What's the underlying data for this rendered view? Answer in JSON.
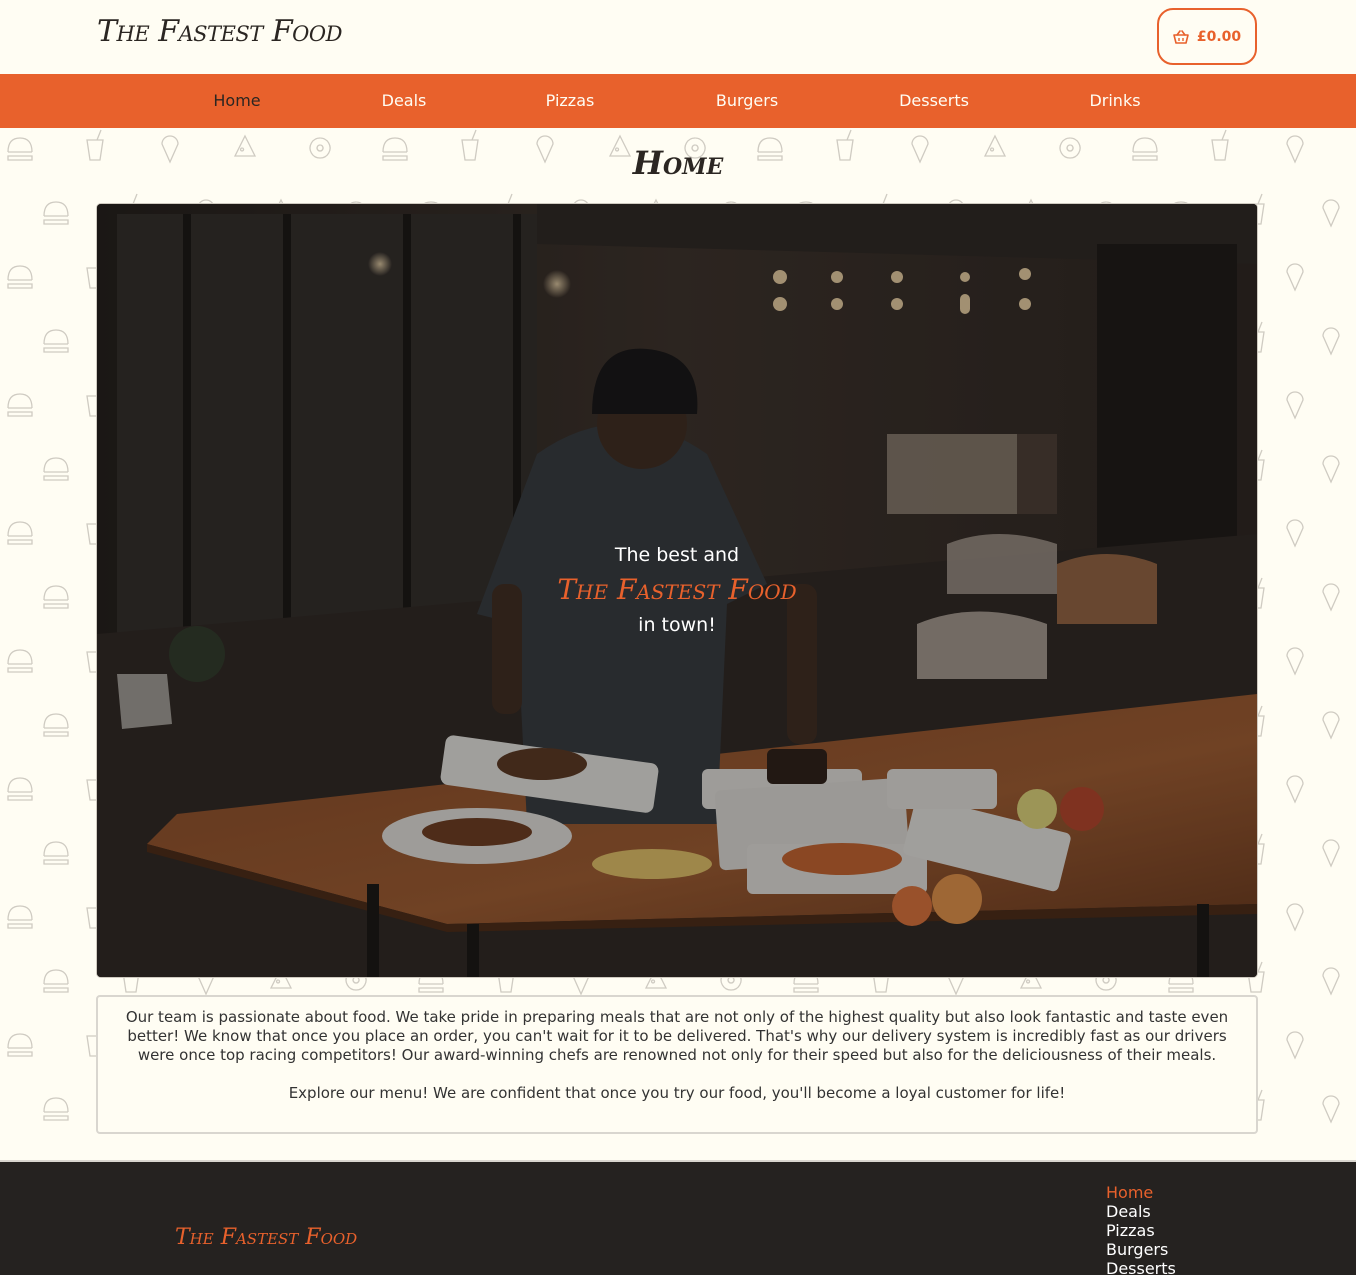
{
  "header": {
    "brand": "The Fastest Food",
    "cart_icon": "basket-icon",
    "cart_total": "£0.00"
  },
  "nav": {
    "items": [
      {
        "label": "Home",
        "active": true
      },
      {
        "label": "Deals",
        "active": false
      },
      {
        "label": "Pizzas",
        "active": false
      },
      {
        "label": "Burgers",
        "active": false
      },
      {
        "label": "Desserts",
        "active": false
      },
      {
        "label": "Drinks",
        "active": false
      }
    ]
  },
  "page": {
    "title": "Home"
  },
  "hero": {
    "line1": "The best and",
    "brand": "The Fastest Food",
    "line3": "in town!"
  },
  "about": {
    "paragraph1": "Our team is passionate about food. We take pride in preparing meals that are not only of the highest quality but also look fantastic and taste even better! We know that once you place an order, you can't wait for it to be delivered. That's why our delivery system is incredibly fast as our drivers were once top racing competitors! Our award-winning chefs are renowned not only for their speed but also for the deliciousness of their meals.",
    "paragraph2": "Explore our menu! We are confident that once you try our food, you'll become a loyal customer for life!"
  },
  "footer": {
    "brand": "The Fastest Food",
    "links": [
      {
        "label": "Home",
        "active": true
      },
      {
        "label": "Deals",
        "active": false
      },
      {
        "label": "Pizzas",
        "active": false
      },
      {
        "label": "Burgers",
        "active": false
      },
      {
        "label": "Desserts",
        "active": false
      }
    ]
  },
  "colors": {
    "accent": "#e8612c",
    "background": "#fffdf3",
    "dark": "#252220",
    "nav_active_text": "#2b2622"
  }
}
